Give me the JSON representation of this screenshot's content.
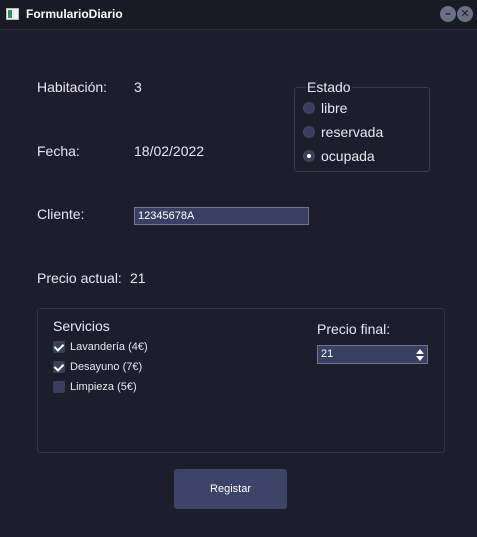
{
  "window": {
    "title": "FormularioDiario",
    "minimize_glyph": "–",
    "close_glyph": "✕"
  },
  "form": {
    "habitacion_label": "Habitación:",
    "habitacion_value": "3",
    "fecha_label": "Fecha:",
    "fecha_value": "18/02/2022",
    "cliente_label": "Cliente:",
    "cliente_value": "12345678A",
    "precio_actual_label": "Precio actual:",
    "precio_actual_value": "21"
  },
  "estado": {
    "title": "Estado",
    "options": [
      {
        "label": "libre",
        "checked": false
      },
      {
        "label": "reservada",
        "checked": false
      },
      {
        "label": "ocupada",
        "checked": true
      }
    ]
  },
  "servicios": {
    "title": "Servicios",
    "items": [
      {
        "label": "Lavandería (4€)",
        "checked": true
      },
      {
        "label": "Desayuno (7€)",
        "checked": true
      },
      {
        "label": "Limpieza (5€)",
        "checked": false
      }
    ]
  },
  "precio_final": {
    "label": "Precio final:",
    "value": "21"
  },
  "actions": {
    "registrar_label": "Registar"
  }
}
